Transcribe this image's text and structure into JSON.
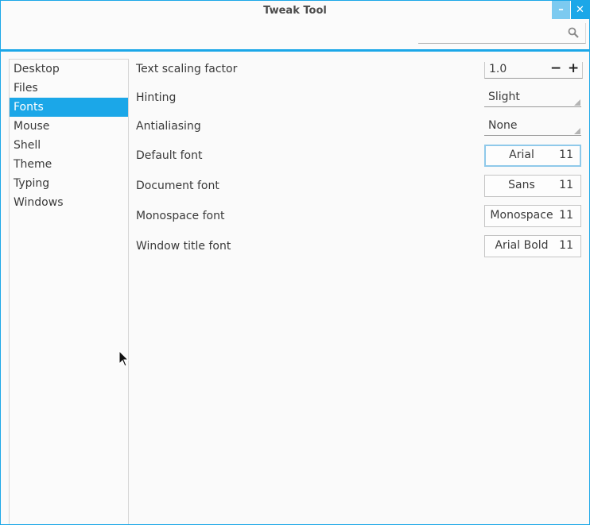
{
  "window": {
    "title": "Tweak Tool",
    "minimize_glyph": "–",
    "close_glyph": "✕",
    "accent_color": "#1ba7e8"
  },
  "search": {
    "value": "",
    "placeholder": "",
    "icon": "search-icon"
  },
  "sidebar": {
    "items": [
      {
        "label": "Desktop"
      },
      {
        "label": "Files"
      },
      {
        "label": "Fonts",
        "selected": true
      },
      {
        "label": "Mouse"
      },
      {
        "label": "Shell"
      },
      {
        "label": "Theme"
      },
      {
        "label": "Typing"
      },
      {
        "label": "Windows"
      }
    ]
  },
  "settings": {
    "text_scaling": {
      "label": "Text scaling factor",
      "value": "1.0",
      "minus": "−",
      "plus": "+"
    },
    "hinting": {
      "label": "Hinting",
      "value": "Slight"
    },
    "antialiasing": {
      "label": "Antialiasing",
      "value": "None"
    },
    "default_font": {
      "label": "Default font",
      "font": "Arial",
      "size": "11"
    },
    "document_font": {
      "label": "Document font",
      "font": "Sans",
      "size": "11"
    },
    "monospace_font": {
      "label": "Monospace font",
      "font": "Monospace",
      "size": "11"
    },
    "window_title_font": {
      "label": "Window title font",
      "font": "Arial Bold",
      "size": "11"
    }
  }
}
